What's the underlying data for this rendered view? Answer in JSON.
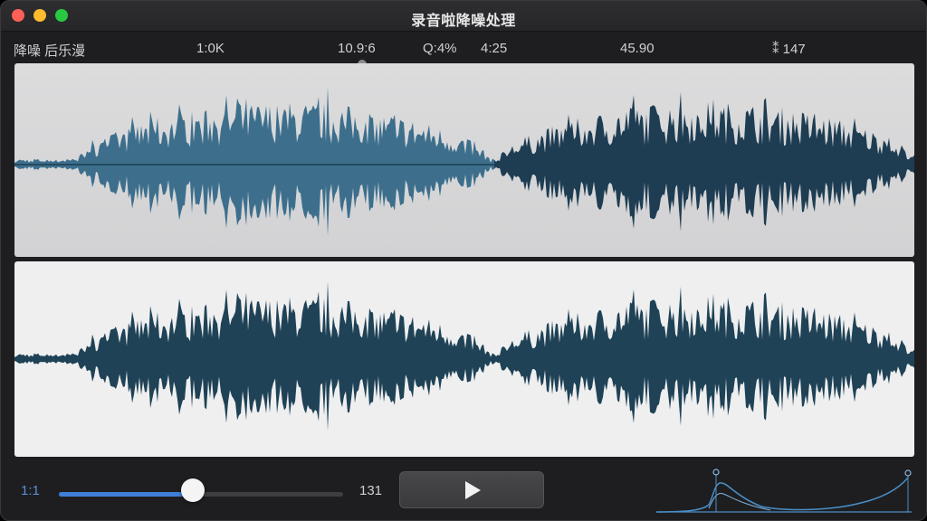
{
  "window": {
    "title": "录音啦降噪处理"
  },
  "toolbar": {
    "label": "降噪 后乐漫",
    "values": [
      "1:0K",
      "10.9:6",
      "Q:4%",
      "4:25",
      "45.90",
      "⁑ 147"
    ]
  },
  "player": {
    "slider_min_label": "1:1",
    "slider_max_label": "131",
    "position_fraction": 0.47,
    "play_icon": "play-icon"
  },
  "colors": {
    "accent": "#3f7fd8",
    "waveform_original_light": "#3d6f8d",
    "waveform_original_dark": "#1e3d53",
    "waveform_processed": "#1f4256",
    "curve": "#4a8fc7"
  }
}
